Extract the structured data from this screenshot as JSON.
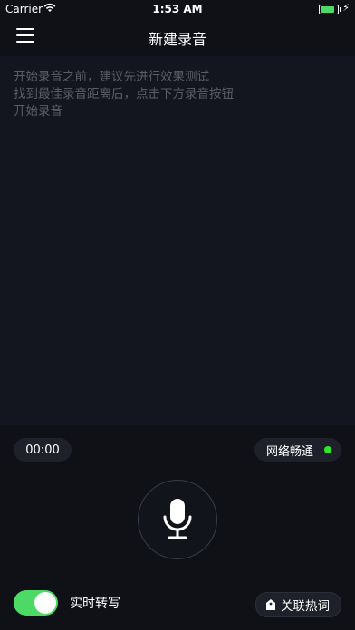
{
  "status_bar": {
    "carrier": "Carrier",
    "time": "1:53 AM",
    "battery_level": 0.9,
    "charging": true
  },
  "nav": {
    "title": "新建录音"
  },
  "hint": {
    "lines": "开始录音之前，建议先进行效果测试\n找到最佳录音距离后，点击下方录音按钮\n开始录音"
  },
  "timer": {
    "value": "00:00"
  },
  "network": {
    "label": "网络畅通",
    "status_color": "#2ae82a"
  },
  "realtime": {
    "label": "实时转写",
    "enabled": true
  },
  "hotwords": {
    "label": "关联热词"
  },
  "colors": {
    "accent": "#4cd964",
    "background": "#0f1117"
  }
}
